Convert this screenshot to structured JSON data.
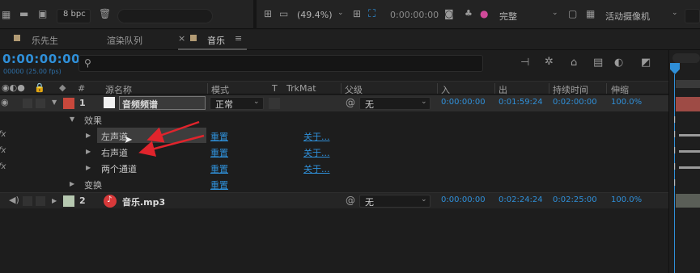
{
  "toolbar": {
    "bpc": "8 bpc",
    "zoom": "(49.4%)",
    "timecode": "0:00:00:00",
    "resolution": "完整",
    "camera": "活动摄像机"
  },
  "tabs": [
    {
      "label": "乐先生",
      "active": false
    },
    {
      "label": "渲染队列",
      "active": false
    },
    {
      "label": "音乐",
      "active": true
    }
  ],
  "tab_close": "×",
  "tab_menu": "≡",
  "composition": {
    "timecode": "0:00:00:00",
    "fps": "00000 (25.00 fps)",
    "search_placeholder": ""
  },
  "columns": {
    "num": "#",
    "source_name": "源名称",
    "mode": "模式",
    "t": "T",
    "trkmat": "TrkMat",
    "parent": "父级",
    "in": "入",
    "out": "出",
    "duration": "持续时间",
    "stretch": "伸缩"
  },
  "layers": [
    {
      "num": "1",
      "name": "音频频谱",
      "mode": "正常",
      "parent": "无",
      "in": "0:00:00:00",
      "out": "0:01:59:24",
      "duration": "0:02:00:00",
      "stretch": "100.0%",
      "label_color": "#c8483c"
    },
    {
      "num": "2",
      "name": "音乐.mp3",
      "parent": "无",
      "in": "0:00:00:00",
      "out": "0:02:24:24",
      "duration": "0:02:25:00",
      "stretch": "100.0%",
      "label_color": "#b6c8b0"
    }
  ],
  "effects_group": "效果",
  "effects": [
    {
      "name": "左声道",
      "reset": "重置",
      "about": "关于..."
    },
    {
      "name": "右声道",
      "reset": "重置",
      "about": "关于..."
    },
    {
      "name": "两个通道",
      "reset": "重置",
      "about": "关于..."
    }
  ],
  "transform": {
    "name": "变换",
    "reset": "重置"
  },
  "fx_label": "fx",
  "colors": {
    "accent": "#2f8fd8",
    "arrow": "#e0242c",
    "playhead": "#2f8fd8",
    "bar": "#9e4b45"
  }
}
